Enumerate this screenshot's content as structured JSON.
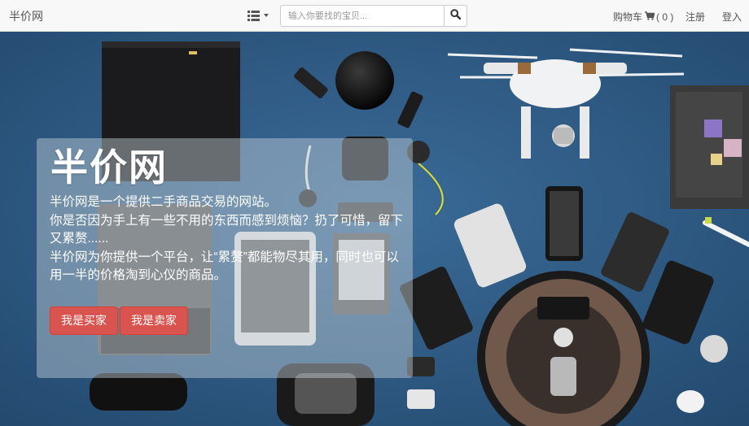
{
  "navbar": {
    "brand": "半价网",
    "category_icon": "list-icon",
    "search": {
      "placeholder": "输入你要找的宝贝...",
      "value": "",
      "icon": "search-icon"
    },
    "cart": {
      "label": "购物车",
      "count_text": "( 0 )",
      "icon": "shopping-cart-icon"
    },
    "register": "注册",
    "login": "登入"
  },
  "hero": {
    "title": "半价网",
    "description": [
      "半价网是一个提供二手商品交易的网站。",
      "你是否因为手上有一些不用的东西而感到烦恼？扔了可惜，留下又累赘......",
      "半价网为你提供一个平台，让“累赘”都能物尽其用，同时也可以用一半的价格淘到心仪的商品。"
    ],
    "buy_button": "我是买家",
    "sell_button": "我是卖家",
    "colors": {
      "button": "#d9534f",
      "background": "#2d5c87"
    }
  }
}
